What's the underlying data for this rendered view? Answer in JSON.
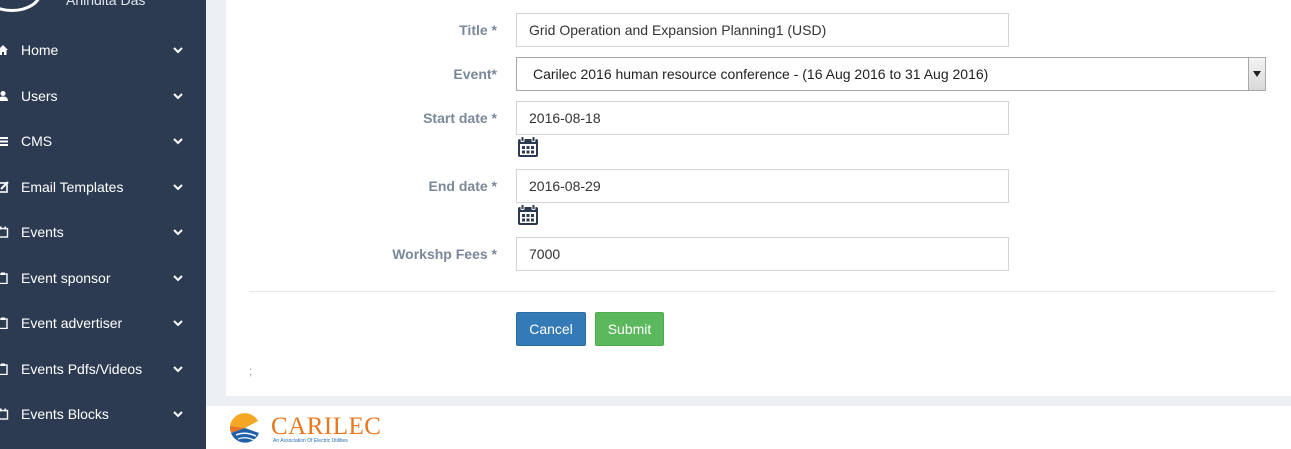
{
  "user": {
    "name": "Anindita Das"
  },
  "sidebar": {
    "items": [
      {
        "label": "Home",
        "icon": "home-icon"
      },
      {
        "label": "Users",
        "icon": "user-icon"
      },
      {
        "label": "CMS",
        "icon": "list-icon"
      },
      {
        "label": "Email Templates",
        "icon": "edit-icon"
      },
      {
        "label": "Events",
        "icon": "calendar-icon"
      },
      {
        "label": "Event sponsor",
        "icon": "clipboard-icon"
      },
      {
        "label": "Event advertiser",
        "icon": "clipboard-icon"
      },
      {
        "label": "Events Pdfs/Videos",
        "icon": "clipboard-icon"
      },
      {
        "label": "Events Blocks",
        "icon": "calendar-icon"
      }
    ]
  },
  "form": {
    "title": {
      "label": "Title *",
      "value": "Grid Operation and Expansion Planning1 (USD)"
    },
    "event": {
      "label": "Event*",
      "value": "Carilec 2016 human resource conference - (16 Aug 2016 to 31 Aug 2016)"
    },
    "start_date": {
      "label": "Start date *",
      "value": "2016-08-18"
    },
    "end_date": {
      "label": "End date *",
      "value": "2016-08-29"
    },
    "fees": {
      "label": "Workshp Fees *",
      "value": "7000"
    },
    "cancel_label": "Cancel",
    "submit_label": "Submit",
    "trailing_text": ";"
  },
  "footer": {
    "logo_text": "CARILEC",
    "logo_tagline": "An Association Of Electric Utilities"
  },
  "colors": {
    "sidebar_bg": "#2c3b52",
    "cancel_button": "#337ab7",
    "submit_button": "#5cb85c",
    "label_text": "#7a8899",
    "logo_orange": "#e8771f"
  }
}
